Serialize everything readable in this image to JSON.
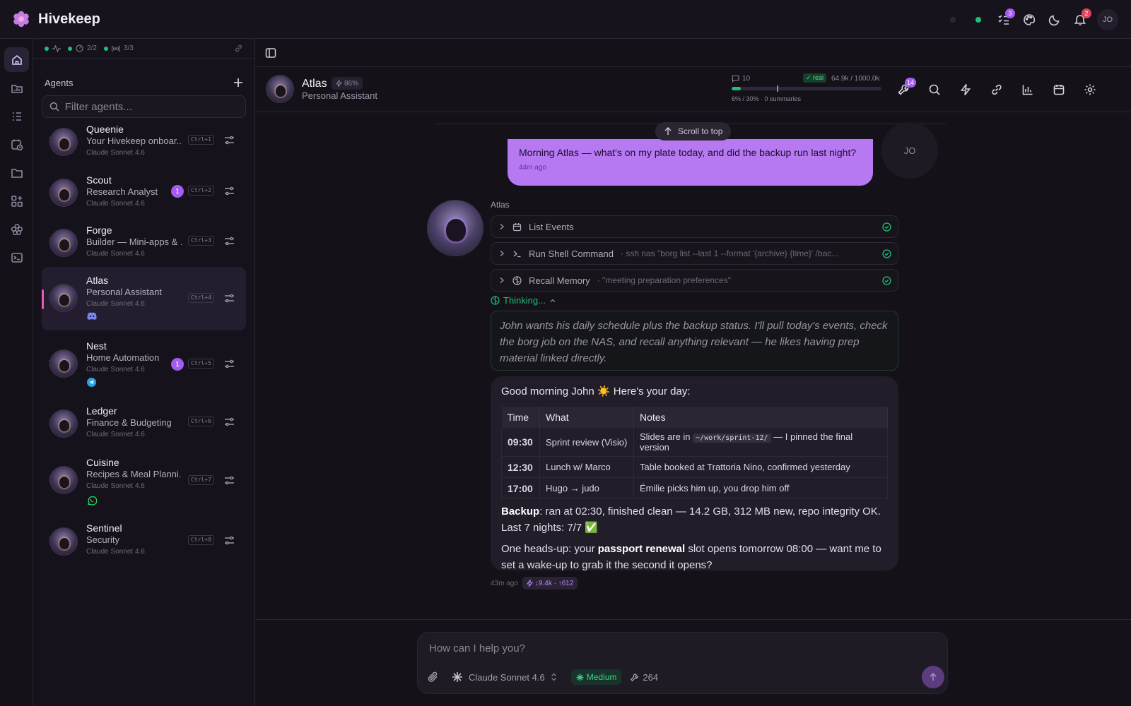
{
  "app": {
    "name": "Hivekeep"
  },
  "topbar": {
    "tasks_badge": "3",
    "notif_badge": "2",
    "user_initials": "JO"
  },
  "status": {
    "sessions": "2/2",
    "channels": "3/3"
  },
  "sidebar": {
    "title": "Agents",
    "filter_placeholder": "Filter agents...",
    "agents": [
      {
        "name": "Queenie",
        "role": "Your Hivekeep onboar...",
        "model": "Claude Sonnet 4.6",
        "shortcut": "Ctrl+1"
      },
      {
        "name": "Scout",
        "role": "Research Analyst",
        "model": "Claude Sonnet 4.6",
        "shortcut": "Ctrl+2",
        "unread": "1"
      },
      {
        "name": "Forge",
        "role": "Builder — Mini-apps & ...",
        "model": "Claude Sonnet 4.6",
        "shortcut": "Ctrl+3"
      },
      {
        "name": "Atlas",
        "role": "Personal Assistant",
        "model": "Claude Sonnet 4.6",
        "shortcut": "Ctrl+4",
        "channel": "discord-icon"
      },
      {
        "name": "Nest",
        "role": "Home Automation",
        "model": "Claude Sonnet 4.6",
        "shortcut": "Ctrl+5",
        "unread": "1",
        "channel": "telegram-icon"
      },
      {
        "name": "Ledger",
        "role": "Finance & Budgeting",
        "model": "Claude Sonnet 4.6",
        "shortcut": "Ctrl+6"
      },
      {
        "name": "Cuisine",
        "role": "Recipes & Meal Planni...",
        "model": "Claude Sonnet 4.6",
        "shortcut": "Ctrl+7",
        "channel": "whatsapp-icon"
      },
      {
        "name": "Sentinel",
        "role": "Security",
        "model": "Claude Sonnet 4.6",
        "shortcut": "Ctrl+8"
      }
    ]
  },
  "header": {
    "name": "Atlas",
    "pct": "86%",
    "role": "Personal Assistant",
    "messages": "10",
    "real_label": "✓ real",
    "tokens": "64.9k / 1000.0k",
    "usage_fraction": 0.06,
    "threshold_fraction": 0.3,
    "context_summary": "6% / 30% · 0 summaries",
    "tools_badge": "14"
  },
  "chat": {
    "scroll_top_label": "Scroll to top",
    "user_message": "Morning Atlas — what's on my plate today, and did the backup run last night?",
    "user_time": "44m ago",
    "user_initials": "JO",
    "bot_name": "Atlas",
    "tools": [
      {
        "name": "List Events",
        "args": ""
      },
      {
        "name": "Run Shell Command",
        "args": "· ssh nas \"borg list --last 1 --format '{archive} {time}' /bac..."
      },
      {
        "name": "Recall Memory",
        "args": "· \"meeting preparation preferences\""
      }
    ],
    "thinking_label": "Thinking...",
    "thinking_text": "John wants his daily schedule plus the backup status. I'll pull today's events, check the borg job on the NAS, and recall anything relevant — he likes having prep material linked directly.",
    "greeting": "Good morning John ☀️ Here's your day:",
    "table": {
      "headers": [
        "Time",
        "What",
        "Notes"
      ],
      "rows": [
        {
          "time": "09:30",
          "what": "Sprint review (Visio)",
          "notes_pre": "Slides are in ",
          "notes_code": "~/work/sprint-12/",
          "notes_post": " — I pinned the final version"
        },
        {
          "time": "12:30",
          "what": "Lunch w/ Marco",
          "notes_pre": "Table booked at Trattoria Nino, confirmed yesterday",
          "notes_code": "",
          "notes_post": ""
        },
        {
          "time": "17:00",
          "what": "Hugo → judo",
          "notes_pre": "Émilie picks him up, you drop him off",
          "notes_code": "",
          "notes_post": ""
        }
      ]
    },
    "backup_label": "Backup",
    "backup_text": ": ran at 02:30, finished clean — 14.2 GB, 312 MB new, repo integrity OK. Last 7 nights: 7/7 ✅",
    "headsup_pre": "One heads-up: your ",
    "headsup_bold": "passport renewal",
    "headsup_post": " slot opens tomorrow 08:00 — want me to set a wake-up to grab it the second it opens?",
    "reply_time": "43m ago",
    "reply_tokens": "↓9.4k · ↑612"
  },
  "composer": {
    "placeholder": "How can I help you?",
    "model": "Claude Sonnet 4.6",
    "effort": "Medium",
    "tool_count": "264"
  },
  "colors": {
    "accent": "#b679f2",
    "ok": "#1fbf76",
    "badge": "#a45cf0",
    "danger": "#e0455e"
  }
}
